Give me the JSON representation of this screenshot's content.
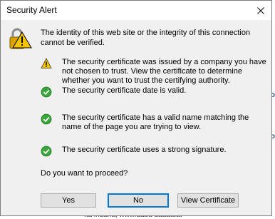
{
  "dialog": {
    "title": "Security Alert",
    "intro": "The identity of this web site or the integrity of this connection cannot be verified.",
    "items": [
      {
        "icon": "warning-icon",
        "text": "The security certificate was issued by a company you have not chosen to trust. View the certificate to determine whether you want to trust the certifying authority."
      },
      {
        "icon": "check-icon",
        "text": "The security certificate date is valid."
      },
      {
        "icon": "check-icon",
        "text": "The security certificate has a valid name matching the name of the page you are trying to view."
      },
      {
        "icon": "check-icon",
        "text": "The security certificate uses a strong signature."
      }
    ],
    "question": "Do you want to proceed?",
    "buttons": {
      "yes": "Yes",
      "no": "No",
      "view": "View Certificate"
    }
  },
  "background": {
    "fragments": [
      "o",
      "o",
      "o",
      "o"
    ],
    "bottom_text": "Ita inaana, www.aaba aaaatuat"
  },
  "colors": {
    "dialog_bg": "#f0f0f0",
    "titlebar_bg": "#ffffff",
    "default_button_border": "#0078d7",
    "check_green": "#3aa53a",
    "warning_yellow": "#f4c400"
  }
}
